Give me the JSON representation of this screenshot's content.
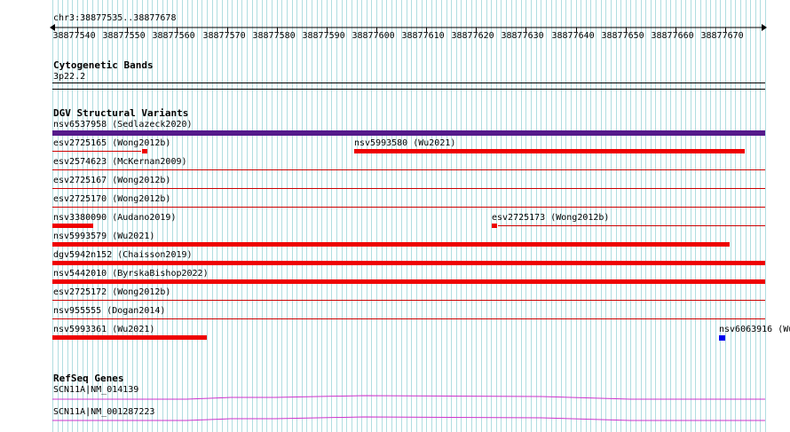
{
  "location": "chr3:38877535..38877678",
  "ruler": {
    "ticks": [
      "38877540",
      "38877550",
      "38877560",
      "38877570",
      "38877580",
      "38877590",
      "38877600",
      "38877610",
      "38877620",
      "38877630",
      "38877640",
      "38877650",
      "38877660",
      "38877670"
    ]
  },
  "tracks": {
    "cytogenetic": {
      "title": "Cytogenetic Bands",
      "band": "3p22.2"
    },
    "dgv": {
      "title": "DGV Structural Variants",
      "sedlazeck": "nsv6537958 (Sedlazeck2020)",
      "rows": [
        {
          "left": "esv2725165 (Wong2012b)",
          "right": "nsv5993580 (Wu2021)"
        },
        {
          "left": "esv2574623 (McKernan2009)"
        },
        {
          "left": "esv2725167 (Wong2012b)"
        },
        {
          "left": "esv2725170 (Wong2012b)"
        },
        {
          "left": "nsv3380090 (Audano2019)",
          "right": "esv2725173 (Wong2012b)"
        },
        {
          "left": "nsv5993579 (Wu2021)"
        },
        {
          "left": "dgv5942n152 (Chaisson2019)"
        },
        {
          "left": "nsv5442010 (ByrskaBishop2022)"
        },
        {
          "left": "esv2725172 (Wong2012b)"
        },
        {
          "left": "nsv955555 (Dogan2014)"
        },
        {
          "left": "nsv5993361 (Wu2021)",
          "right": "nsv6063916 (Wu"
        }
      ]
    },
    "refseq": {
      "title": "RefSeq Genes",
      "genes": [
        "SCN11A|NM_014139",
        "SCN11A|NM_001287223"
      ]
    }
  },
  "colors": {
    "grid": "#b0dde0",
    "variant": "#ee0000",
    "sedlazeck": "#551a8b",
    "blue": "#0000ee",
    "gene": "#cc33cc"
  }
}
